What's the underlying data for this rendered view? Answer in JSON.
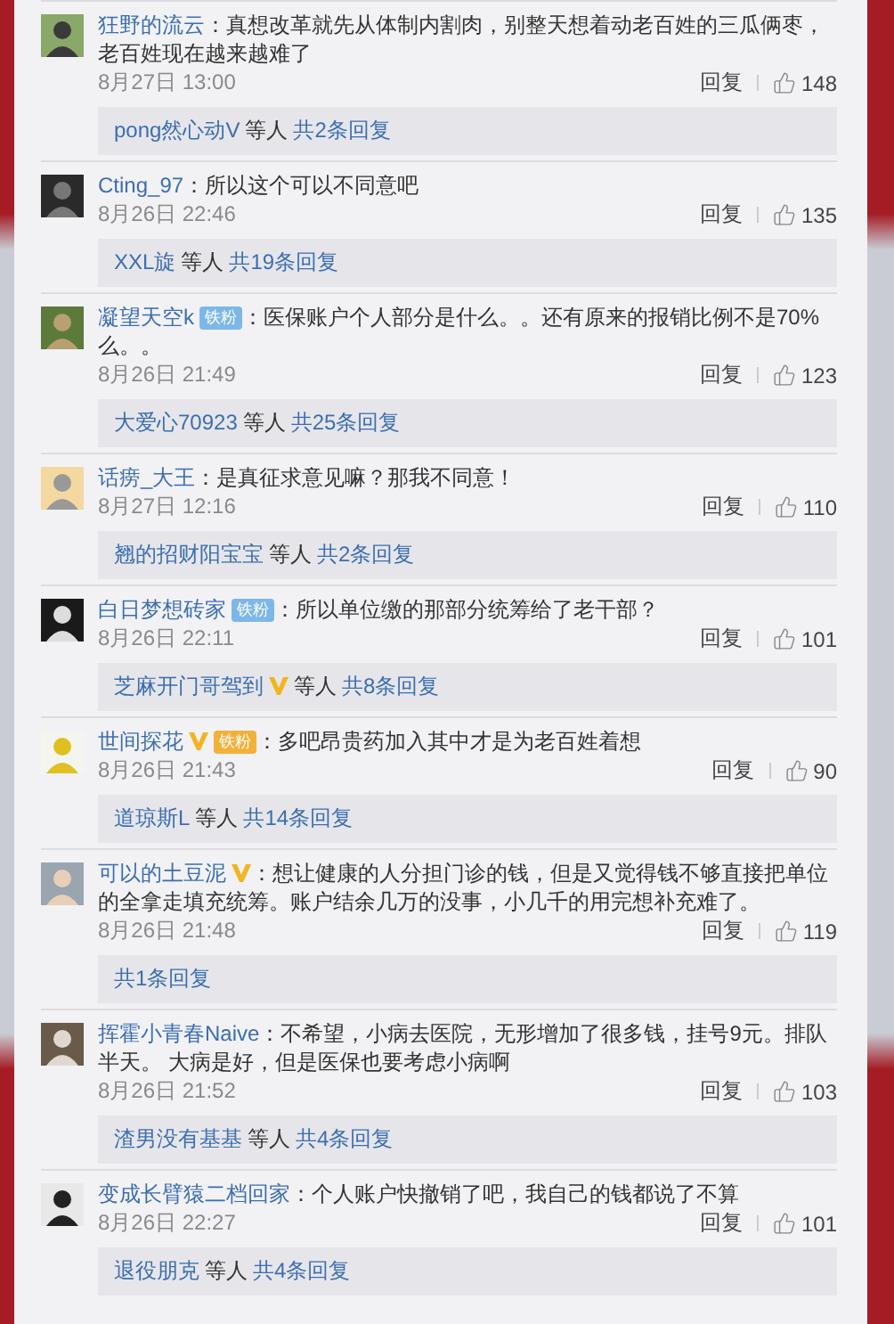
{
  "comments": [
    {
      "user": "狂野的流云",
      "verified": false,
      "text": "：真想改革就先从体制内割肉，别整天想着动老百姓的三瓜俩枣，老百姓现在越来越难了",
      "date": "8月27日 13:00",
      "reply": "回复",
      "likes": "148",
      "thread": {
        "user": "pong然心动V",
        "user_verified": false,
        "others": "等人",
        "count": "共2条回复"
      }
    },
    {
      "user": "Cting_97",
      "verified": false,
      "text": "：所以这个可以不同意吧",
      "date": "8月26日 22:46",
      "reply": "回复",
      "likes": "135",
      "thread": {
        "user": "XXL旋",
        "user_verified": false,
        "others": "等人",
        "count": "共19条回复"
      }
    },
    {
      "user": "凝望天空k",
      "verified": false,
      "badge": {
        "label": "铁粉",
        "kind": "blue"
      },
      "text": "：医保账户个人部分是什么。。还有原来的报销比例不是70%么。。",
      "date": "8月26日 21:49",
      "reply": "回复",
      "likes": "123",
      "thread": {
        "user": "大爱心70923",
        "user_verified": false,
        "others": "等人",
        "count": "共25条回复"
      }
    },
    {
      "user": "话痨_大王",
      "verified": false,
      "text": "：是真征求意见嘛？那我不同意！",
      "date": "8月27日 12:16",
      "reply": "回复",
      "likes": "110",
      "thread": {
        "user": "翘的招财阳宝宝",
        "user_verified": false,
        "others": "等人",
        "count": "共2条回复"
      }
    },
    {
      "user": "白日梦想砖家",
      "verified": false,
      "badge": {
        "label": "铁粉",
        "kind": "blue"
      },
      "text": "：所以单位缴的那部分统筹给了老干部？",
      "date": "8月26日 22:11",
      "reply": "回复",
      "likes": "101",
      "thread": {
        "user": "芝麻开门哥驾到",
        "user_verified": true,
        "others": "等人",
        "count": "共8条回复"
      }
    },
    {
      "user": "世间探花",
      "verified": true,
      "badge": {
        "label": "铁粉",
        "kind": "gold"
      },
      "text": "：多吧昂贵药加入其中才是为老百姓着想",
      "date": "8月26日 21:43",
      "reply": "回复",
      "likes": "90",
      "thread": {
        "user": "道琼斯L",
        "user_verified": false,
        "others": "等人",
        "count": "共14条回复"
      }
    },
    {
      "user": "可以的土豆泥",
      "verified": true,
      "text": "：想让健康的人分担门诊的钱，但是又觉得钱不够直接把单位的全拿走填充统筹。账户结余几万的没事，小几千的用完想补充难了。",
      "date": "8月26日 21:48",
      "reply": "回复",
      "likes": "119",
      "thread": {
        "count": "共1条回复"
      }
    },
    {
      "user": "挥霍小青春Naive",
      "verified": false,
      "text": "：不希望，小病去医院，无形增加了很多钱，挂号9元。排队半天。 大病是好，但是医保也要考虑小病啊",
      "date": "8月26日 21:52",
      "reply": "回复",
      "likes": "103",
      "thread": {
        "user": "渣男没有基基",
        "user_verified": false,
        "others": "等人",
        "count": "共4条回复"
      }
    },
    {
      "user": "变成长臂猿二档回家",
      "verified": false,
      "text": "：个人账户快撤销了吧，我自己的钱都说了不算",
      "date": "8月26日 22:27",
      "reply": "回复",
      "likes": "101",
      "thread": {
        "user": "退役朋克",
        "user_verified": false,
        "others": "等人",
        "count": "共4条回复"
      }
    }
  ]
}
